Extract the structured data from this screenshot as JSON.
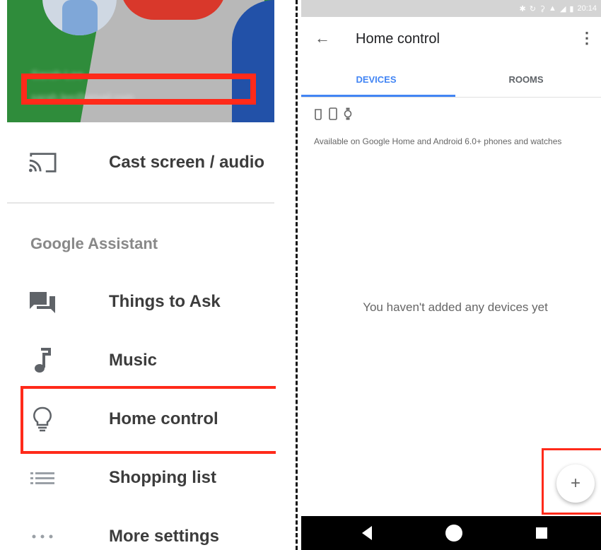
{
  "left_panel": {
    "account": {
      "name": "Sarah Lee",
      "email": "sarah.lee@gmail.com"
    },
    "menu": {
      "cast": "Cast screen / audio"
    },
    "section_title": "Google Assistant",
    "items": [
      {
        "label": "Things to Ask",
        "icon": "chat-bubbles-icon"
      },
      {
        "label": "Music",
        "icon": "music-note-icon"
      },
      {
        "label": "Home control",
        "icon": "lightbulb-icon"
      },
      {
        "label": "Shopping list",
        "icon": "list-icon"
      },
      {
        "label": "More settings",
        "icon": "more-horizontal-icon"
      }
    ]
  },
  "phone": {
    "status_bar": {
      "time": "20:14",
      "icons": [
        "bluetooth-icon",
        "sync-icon",
        "key-icon",
        "wifi-icon",
        "signal-icon",
        "battery-icon"
      ]
    },
    "app_bar": {
      "title": "Home control"
    },
    "tabs": [
      {
        "label": "DEVICES",
        "selected": true
      },
      {
        "label": "ROOMS",
        "selected": false
      }
    ],
    "availability_text": "Available on Google Home and Android 6.0+ phones and watches",
    "empty_state": "You haven't added any devices yet",
    "fab": {
      "label": "+"
    }
  },
  "colors": {
    "accent": "#4285f4",
    "highlight": "#ff2a1a",
    "header_green": "#2f8c3b",
    "header_blue": "#2251a8",
    "header_red": "#d9382b"
  }
}
